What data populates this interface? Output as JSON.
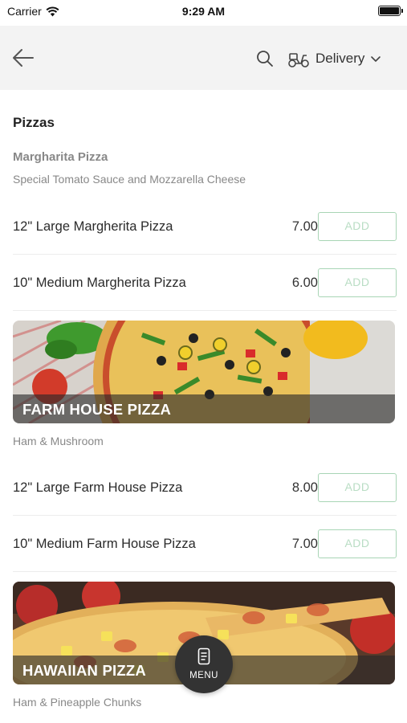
{
  "status_bar": {
    "carrier": "Carrier",
    "time": "9:29 AM"
  },
  "nav": {
    "back_icon": "arrow-left-icon",
    "search_icon": "search-icon",
    "delivery_icon": "scooter-icon",
    "delivery_label": "Delivery",
    "chevron_icon": "chevron-down-icon"
  },
  "section": {
    "title": "Pizzas"
  },
  "groups": [
    {
      "title": "Margharita Pizza",
      "description": "Special Tomato Sauce and Mozzarella Cheese",
      "items": [
        {
          "name": "12\" Large Margherita Pizza",
          "price": "7.00",
          "button": "ADD"
        },
        {
          "name": "10\" Medium Margherita Pizza",
          "price": "6.00",
          "button": "ADD"
        }
      ]
    },
    {
      "title": "FARM HOUSE PIZZA",
      "description": "Ham & Mushroom",
      "items": [
        {
          "name": "12\" Large Farm House Pizza",
          "price": "8.00",
          "button": "ADD"
        },
        {
          "name": "10\" Medium Farm House Pizza",
          "price": "7.00",
          "button": "ADD"
        }
      ]
    },
    {
      "title": "HAWAIIAN PIZZA",
      "description": "Ham & Pineapple Chunks",
      "items": []
    }
  ],
  "menu_button": {
    "icon": "menu-card-icon",
    "label": "MENU"
  },
  "colors": {
    "nav_background": "#f3f3f3",
    "add_border": "#a8d5b5",
    "add_text": "#b9ddc4",
    "fab_background": "#333333"
  }
}
